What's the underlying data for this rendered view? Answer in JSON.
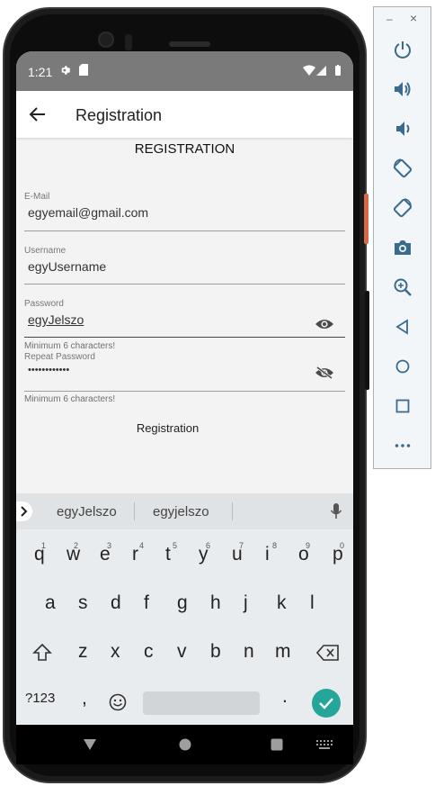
{
  "status_bar": {
    "time": "1:21"
  },
  "app_bar": {
    "title": "Registration"
  },
  "form": {
    "heading": "REGISTRATION",
    "email": {
      "label": "E-Mail",
      "value": "egyemail@gmail.com"
    },
    "username": {
      "label": "Username",
      "value": "egyUsername"
    },
    "password": {
      "label": "Password",
      "value": "egyJelszo",
      "helper": "Minimum 6 characters!"
    },
    "repeat_password": {
      "label": "Repeat Password",
      "value": "••••••••••••",
      "helper": "Minimum 6 characters!"
    },
    "submit_label": "Registration"
  },
  "keyboard": {
    "suggestions": [
      "egyJelszo",
      "egyjelszo"
    ],
    "row1": [
      {
        "k": "q",
        "n": "1"
      },
      {
        "k": "w",
        "n": "2"
      },
      {
        "k": "e",
        "n": "3"
      },
      {
        "k": "r",
        "n": "4"
      },
      {
        "k": "t",
        "n": "5"
      },
      {
        "k": "y",
        "n": "6"
      },
      {
        "k": "u",
        "n": "7"
      },
      {
        "k": "i",
        "n": "8"
      },
      {
        "k": "o",
        "n": "9"
      },
      {
        "k": "p",
        "n": "0"
      }
    ],
    "row2": [
      "a",
      "s",
      "d",
      "f",
      "g",
      "h",
      "j",
      "k",
      "l"
    ],
    "row3": [
      "z",
      "x",
      "c",
      "v",
      "b",
      "n",
      "m"
    ],
    "symbols_label": "?123",
    "comma": ",",
    "period": "."
  },
  "colors": {
    "accent": "#26a69a",
    "status_bar": "#7a7a7a",
    "screen_bg": "#f3f3f3"
  },
  "emulator_panel": {
    "minimize": "–",
    "close": "×",
    "icons": [
      "power-icon",
      "volume-up-icon",
      "volume-down-icon",
      "rotate-left-icon",
      "rotate-right-icon",
      "camera-icon",
      "zoom-icon",
      "back-icon",
      "home-icon",
      "overview-icon",
      "more-icon"
    ]
  }
}
